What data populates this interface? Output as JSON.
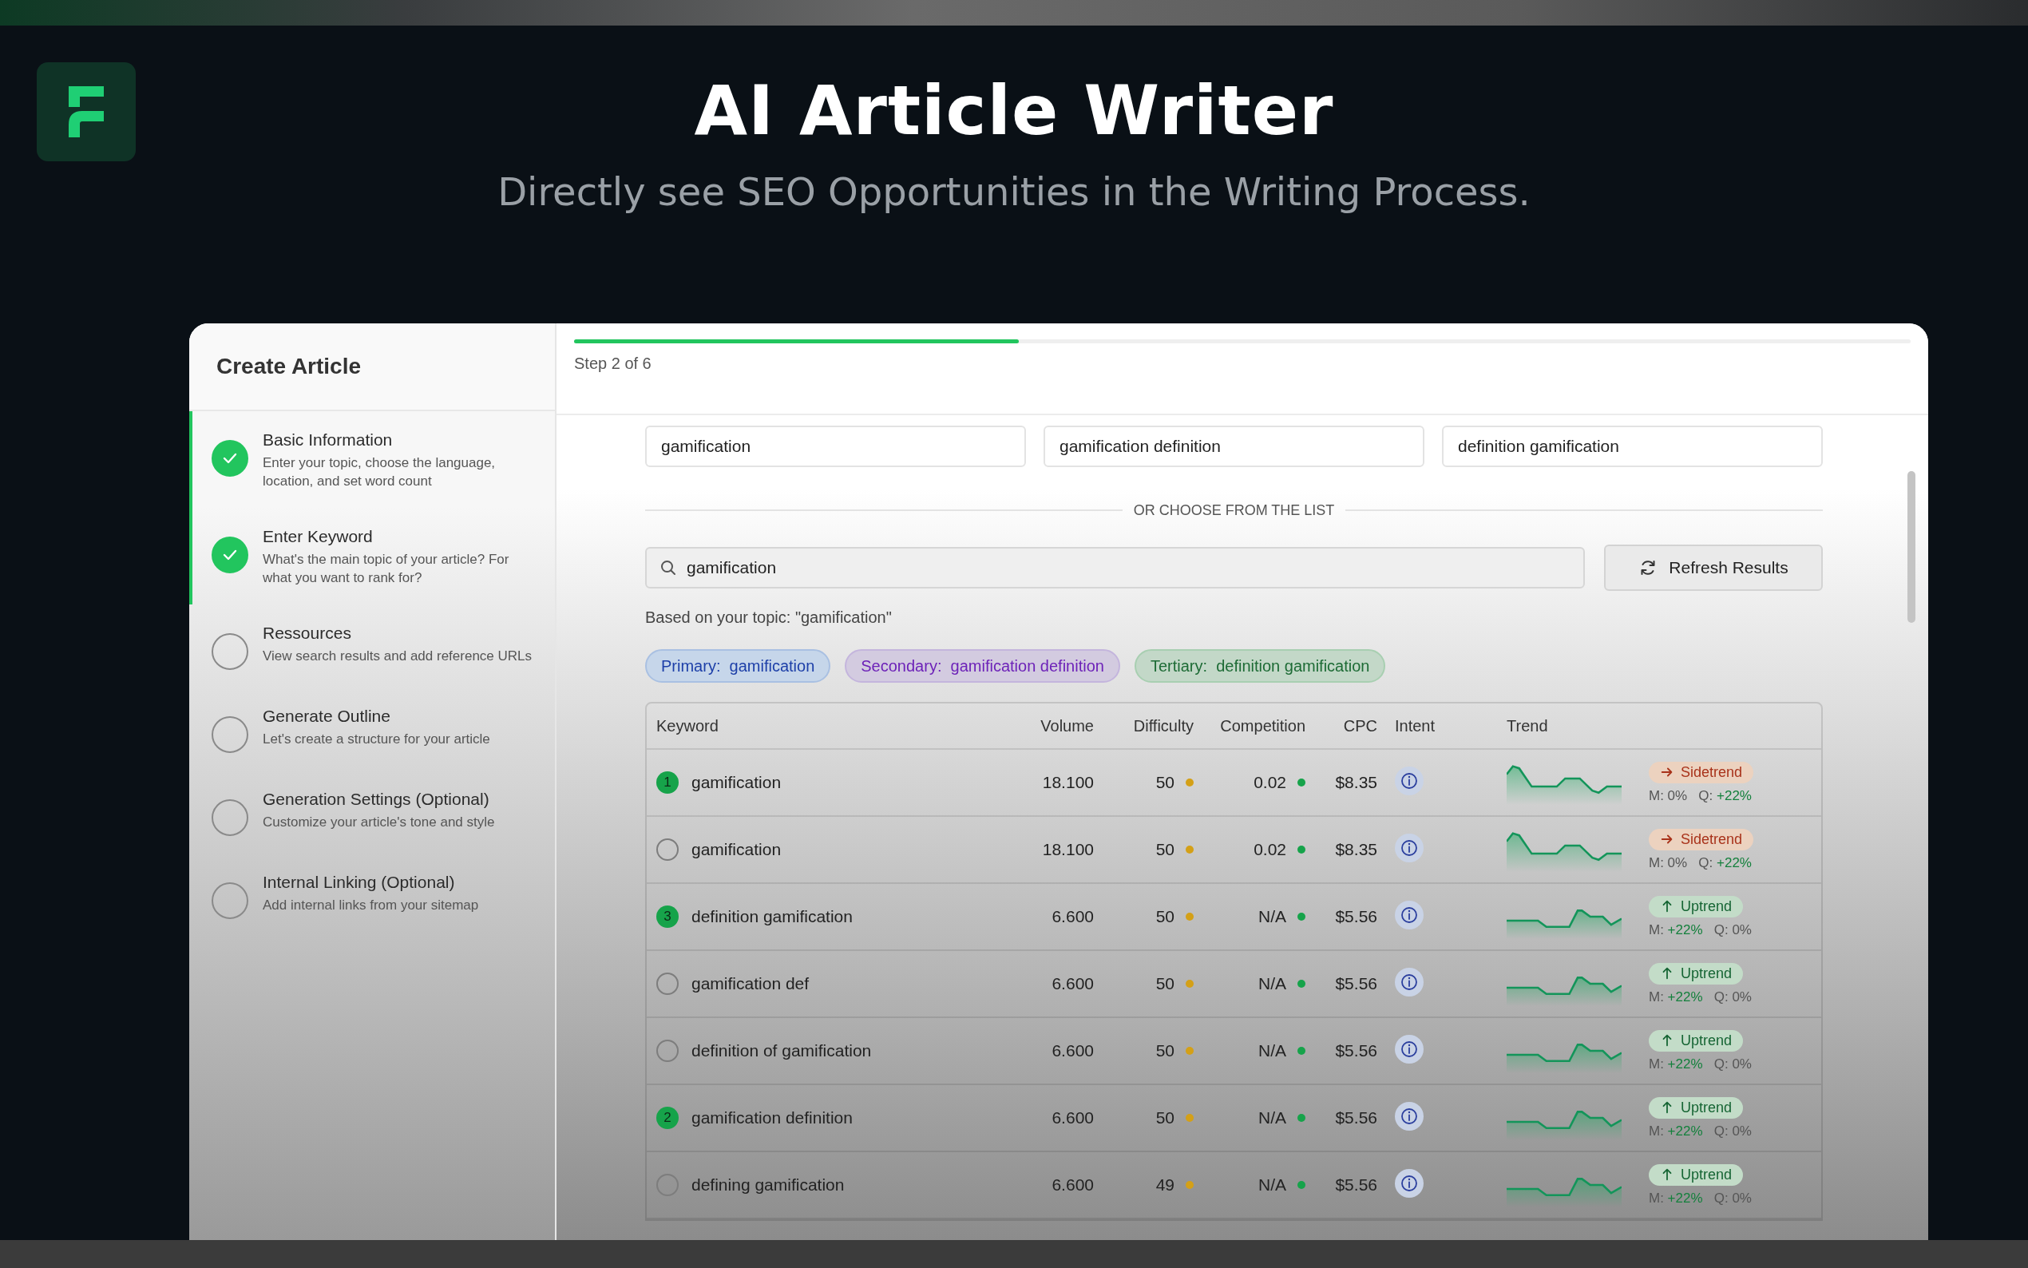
{
  "hero": {
    "title": "AI Article Writer",
    "subtitle": "Directly see SEO Opportunities in the Writing Process."
  },
  "sidebar": {
    "title": "Create Article",
    "steps": [
      {
        "title": "Basic Information",
        "description": "Enter your topic, choose the language, location, and set word count",
        "completed": true
      },
      {
        "title": "Enter Keyword",
        "description": "What's the main topic of your article? For what you want to rank for?",
        "completed": true
      },
      {
        "title": "Ressources",
        "description": "View search results and add reference URLs",
        "completed": false
      },
      {
        "title": "Generate Outline",
        "description": "Let's create a structure for your article",
        "completed": false
      },
      {
        "title": "Generation Settings (Optional)",
        "description": "Customize your article's tone and style",
        "completed": false
      },
      {
        "title": "Internal Linking (Optional)",
        "description": "Add internal links from your sitemap",
        "completed": false
      }
    ]
  },
  "progress": {
    "level": 0.333,
    "label": "Step 2 of 6"
  },
  "keyword_fields": [
    {
      "value": "gamification"
    },
    {
      "value": "gamification definition"
    },
    {
      "value": "definition gamification"
    }
  ],
  "divider_label": "OR CHOOSE FROM THE LIST",
  "search": {
    "value": "gamification"
  },
  "refresh_button": "Refresh Results",
  "topic_note": "Based on your topic: \"gamification\"",
  "tags": [
    {
      "kind": "primary",
      "text": "Primary:  gamification"
    },
    {
      "kind": "secondary",
      "text": "Secondary:  gamification definition"
    },
    {
      "kind": "tertiary",
      "text": "Tertiary:  definition gamification"
    }
  ],
  "table": {
    "columns": [
      "Keyword",
      "Volume",
      "Difficulty",
      "Competition",
      "CPC",
      "Intent",
      "Trend"
    ],
    "rows": [
      {
        "selected": true,
        "rank": "1",
        "keyword": "gamification",
        "volume": "18.100",
        "difficulty": "50",
        "competition": "0.02",
        "cpc": "$8.35",
        "kind": "sidetrend",
        "trend_label": "Sidetrend",
        "m_label": "M:",
        "m": "0%",
        "m_up": false,
        "q_label": "Q:",
        "q": "+22%",
        "q_up": true
      },
      {
        "selected": false,
        "keyword": "gamification",
        "volume": "18.100",
        "difficulty": "50",
        "competition": "0.02",
        "cpc": "$8.35",
        "kind": "sidetrend",
        "trend_label": "Sidetrend",
        "m_label": "M:",
        "m": "0%",
        "m_up": false,
        "q_label": "Q:",
        "q": "+22%",
        "q_up": true
      },
      {
        "selected": true,
        "rank": "3",
        "keyword": "definition gamification",
        "volume": "6.600",
        "difficulty": "50",
        "competition": "N/A",
        "cpc": "$5.56",
        "kind": "uptrend",
        "trend_label": "Uptrend",
        "m_label": "M:",
        "m": "+22%",
        "m_up": true,
        "q_label": "Q:",
        "q": "0%",
        "q_up": false
      },
      {
        "selected": false,
        "keyword": "gamification def",
        "volume": "6.600",
        "difficulty": "50",
        "competition": "N/A",
        "cpc": "$5.56",
        "kind": "uptrend",
        "trend_label": "Uptrend",
        "m_label": "M:",
        "m": "+22%",
        "m_up": true,
        "q_label": "Q:",
        "q": "0%",
        "q_up": false
      },
      {
        "selected": false,
        "keyword": "definition of gamification",
        "volume": "6.600",
        "difficulty": "50",
        "competition": "N/A",
        "cpc": "$5.56",
        "kind": "uptrend",
        "trend_label": "Uptrend",
        "m_label": "M:",
        "m": "+22%",
        "m_up": true,
        "q_label": "Q:",
        "q": "0%",
        "q_up": false
      },
      {
        "selected": true,
        "rank": "2",
        "keyword": "gamification definition",
        "volume": "6.600",
        "difficulty": "50",
        "competition": "N/A",
        "cpc": "$5.56",
        "kind": "uptrend",
        "trend_label": "Uptrend",
        "m_label": "M:",
        "m": "+22%",
        "m_up": true,
        "q_label": "Q:",
        "q": "0%",
        "q_up": false
      },
      {
        "selected": false,
        "keyword": "defining gamification",
        "volume": "6.600",
        "difficulty": "49",
        "competition": "N/A",
        "cpc": "$5.56",
        "kind": "uptrend",
        "trend_label": "Uptrend",
        "m_label": "M:",
        "m": "+22%",
        "m_up": true,
        "q_label": "Q:",
        "q": "0%",
        "q_up": false
      }
    ]
  }
}
